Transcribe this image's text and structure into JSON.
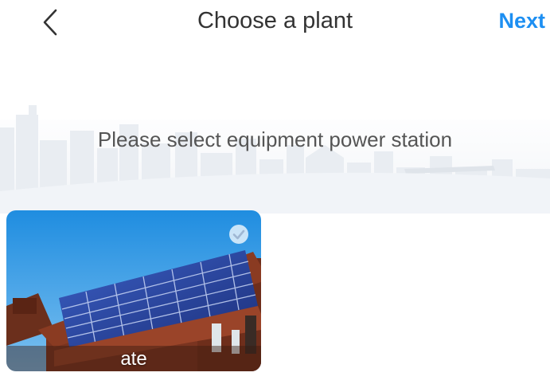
{
  "header": {
    "title": "Choose a plant",
    "next_label": "Next",
    "back_icon": "chevron-left-icon"
  },
  "banner": {
    "prompt": "Please select equipment power station"
  },
  "plants": [
    {
      "name": "ate",
      "selected": true,
      "check_icon": "check-circle-icon"
    }
  ],
  "colors": {
    "accent": "#1d8ff2",
    "title": "#333333",
    "prompt": "#555555",
    "banner_skyline": "#eef1f5"
  }
}
